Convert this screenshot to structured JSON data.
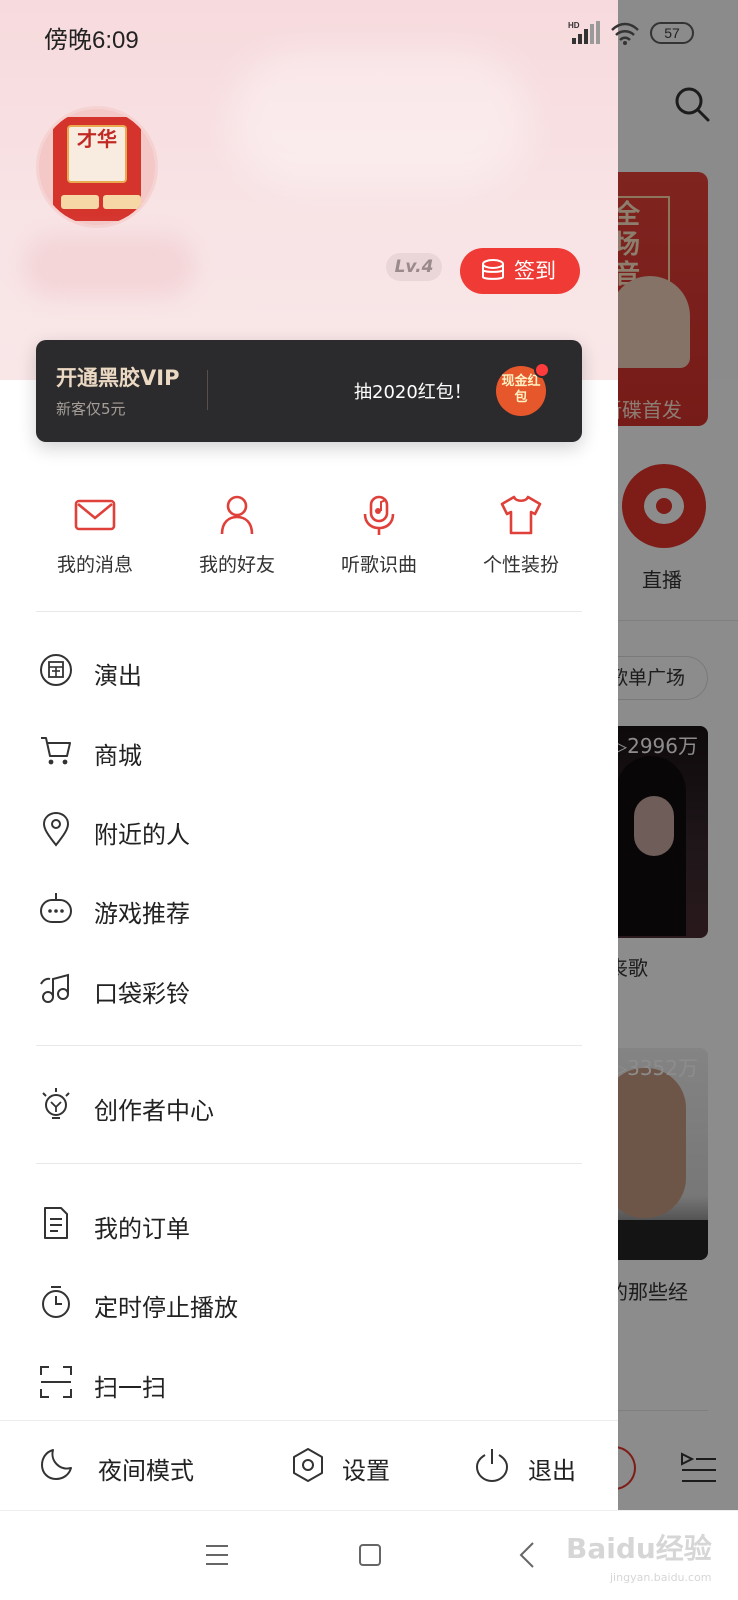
{
  "status_bar": {
    "time": "傍晚6:09",
    "network_label": "HD",
    "battery": "57"
  },
  "profile": {
    "level": "Lv.4",
    "checkin_label": "签到",
    "avatar_text": "才华"
  },
  "vip": {
    "title": "开通黑胶VIP",
    "subtitle": "新客仅5元",
    "promo": "抽2020红包！",
    "redpacket_text": "现金红包"
  },
  "quick_actions": [
    {
      "label": "我的消息",
      "icon": "envelope-icon"
    },
    {
      "label": "我的好友",
      "icon": "person-icon"
    },
    {
      "label": "听歌识曲",
      "icon": "microphone-music-icon"
    },
    {
      "label": "个性装扮",
      "icon": "tshirt-icon"
    }
  ],
  "menu": {
    "group1": [
      {
        "label": "演出",
        "icon": "ticket-icon"
      },
      {
        "label": "商城",
        "icon": "cart-icon"
      },
      {
        "label": "附近的人",
        "icon": "location-pin-icon"
      },
      {
        "label": "游戏推荐",
        "icon": "gamepad-icon"
      },
      {
        "label": "口袋彩铃",
        "icon": "music-note-icon"
      }
    ],
    "group2": [
      {
        "label": "创作者中心",
        "icon": "lightbulb-icon"
      }
    ],
    "group3": [
      {
        "label": "我的订单",
        "icon": "document-icon"
      },
      {
        "label": "定时停止播放",
        "icon": "timer-icon"
      },
      {
        "label": "扫一扫",
        "icon": "scan-icon"
      }
    ]
  },
  "footer": {
    "night_mode": "夜间模式",
    "settings": "设置",
    "logout": "退出"
  },
  "background": {
    "banner_title": "全场音频",
    "banner_sub": "新碟首发",
    "live_label": "直播",
    "playlist_chip": "歌单广场",
    "cards": [
      {
        "count": "▷2996万",
        "caption": "丧歌"
      },
      {
        "count": "▷3352万",
        "caption": "的那些经"
      }
    ]
  },
  "watermark": {
    "text": "Baidu经验",
    "sub": "jingyan.baidu.com"
  },
  "colors": {
    "accent": "#f03a35",
    "vip_bg": "#2b2a2c",
    "vip_text": "#ecd9c4"
  }
}
